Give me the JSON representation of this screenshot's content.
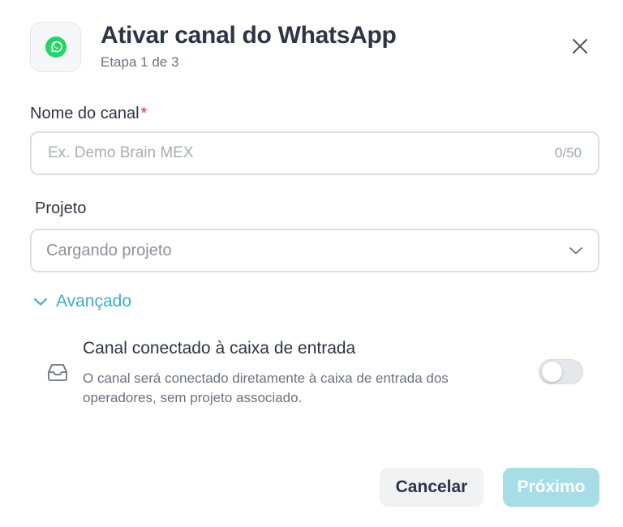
{
  "header": {
    "title": "Ativar canal do WhatsApp",
    "step": "Etapa 1 de 3",
    "app_icon": "whatsapp-icon",
    "close_icon": "close-icon"
  },
  "form": {
    "name_label": "Nome do canal",
    "name_required_mark": "*",
    "name_value": "",
    "name_placeholder": "Ex. Demo Brain MEX",
    "name_counter": "0/50",
    "project_label": "Projeto",
    "project_value": "Cargando projeto"
  },
  "advanced": {
    "label": "Avançado",
    "expanded": true,
    "option_title": "Canal conectado à caixa de entrada",
    "option_description": "O canal será conectado diretamente à caixa de entrada dos operadores, sem projeto associado.",
    "option_enabled": false
  },
  "footer": {
    "cancel_label": "Cancelar",
    "next_label": "Próximo"
  },
  "colors": {
    "accent": "#3eaec4",
    "primary_disabled": "#a7dde6",
    "whatsapp_green": "#25d366",
    "required": "#e03131"
  }
}
